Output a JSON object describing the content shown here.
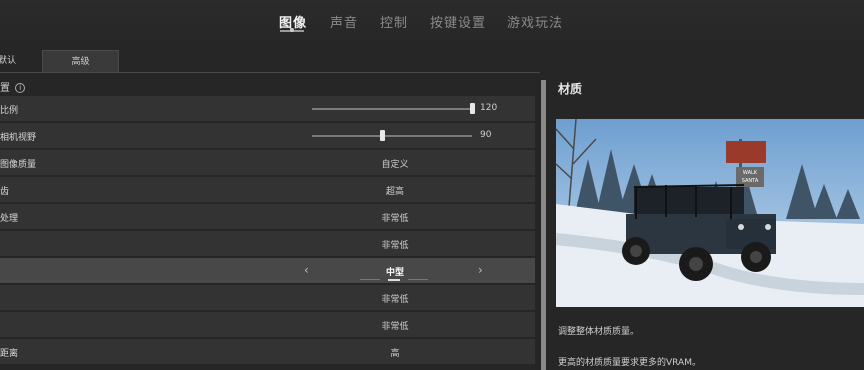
{
  "nav": {
    "tabs": [
      {
        "label": "图像",
        "active": true
      },
      {
        "label": "声音"
      },
      {
        "label": "控制"
      },
      {
        "label": "按键设置"
      },
      {
        "label": "游戏玩法"
      }
    ]
  },
  "subtabs": [
    "默认",
    "高级"
  ],
  "section_title": "置",
  "info_glyph": "i",
  "rows": [
    {
      "label": "比例",
      "type": "slider",
      "value": "120",
      "level": 1.0
    },
    {
      "label": "相机视野",
      "type": "slider",
      "value": "90",
      "level": 0.44
    },
    {
      "label": "图像质量",
      "type": "value",
      "value": "自定义"
    },
    {
      "label": "齿",
      "type": "value",
      "value": "超高"
    },
    {
      "label": "处理",
      "type": "value",
      "value": "非常低"
    },
    {
      "label": "",
      "type": "value",
      "value": "非常低"
    },
    {
      "label": "",
      "type": "selector",
      "value": "中型",
      "left_arrow": "‹",
      "right_arrow": "›"
    },
    {
      "label": "",
      "type": "value",
      "value": "非常低"
    },
    {
      "label": "",
      "type": "value",
      "value": "非常低"
    },
    {
      "label": "距离",
      "type": "value",
      "value": "高"
    }
  ],
  "panel": {
    "title": "材质",
    "sign_text": "WALK\nSANTA",
    "desc1": "调整整体材质质量。",
    "desc2": "更高的材质质量要求更多的VRAM。"
  }
}
